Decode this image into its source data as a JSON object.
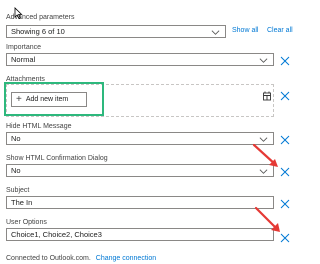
{
  "advanced": {
    "label": "Advanced parameters",
    "select_value": "Showing 6 of 10",
    "show_all": "Show all",
    "clear_all": "Clear all"
  },
  "importance": {
    "label": "Importance",
    "value": "Normal"
  },
  "attachments": {
    "label": "Attachments",
    "add_item": "Add new item"
  },
  "hide_html": {
    "label": "Hide HTML Message",
    "value": "No"
  },
  "show_html_confirm": {
    "label": "Show HTML Confirmation Dialog",
    "value": "No"
  },
  "subject": {
    "label": "Subject",
    "value": "The In"
  },
  "user_options": {
    "label": "User Options",
    "value": "Choice1, Choice2, Choice3"
  },
  "footer": {
    "connected_text": "Connected to Outlook.com.",
    "change_connection": "Change connection"
  },
  "colors": {
    "accent": "#0078d4",
    "highlight_box": "#2db87d",
    "annotation_arrow": "#e53935",
    "border": "#8a8886"
  }
}
